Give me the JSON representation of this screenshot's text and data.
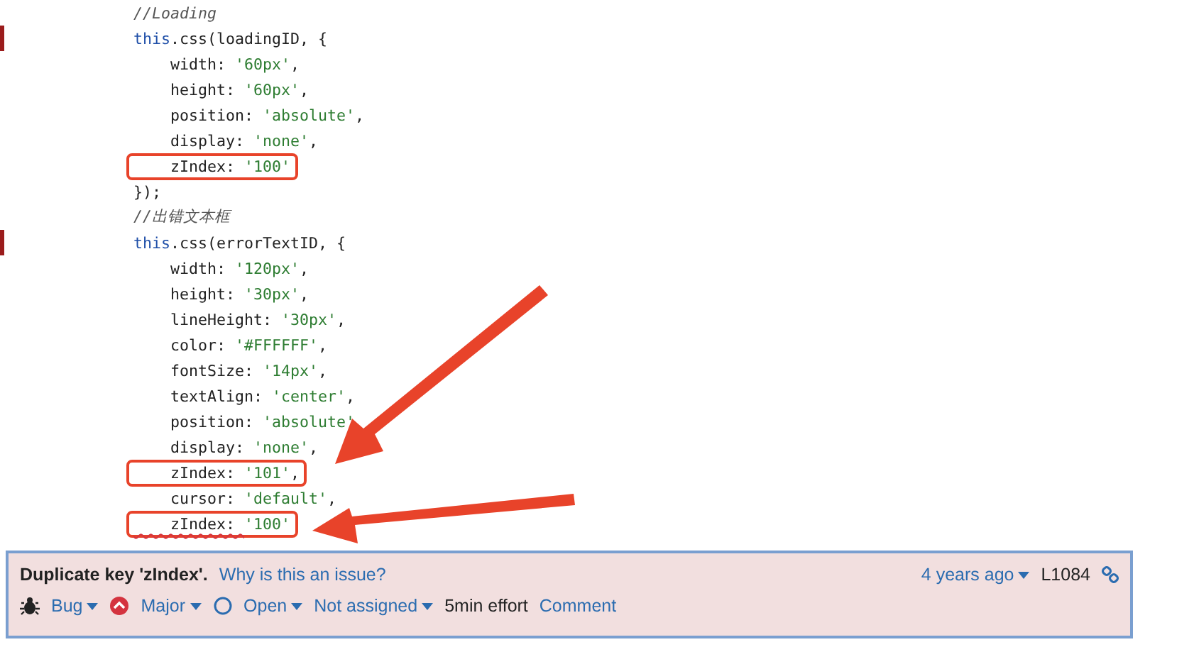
{
  "code_lines": [
    {
      "marked": false,
      "boxed": false,
      "issue": false,
      "tokens": [
        {
          "kind": "comment",
          "text": "//Loading"
        }
      ]
    },
    {
      "marked": true,
      "boxed": false,
      "issue": false,
      "tokens": [
        {
          "kind": "keyword",
          "text": "this"
        },
        {
          "kind": "plain",
          "text": ".css(loadingID, {"
        }
      ]
    },
    {
      "marked": false,
      "boxed": false,
      "issue": false,
      "tokens": [
        {
          "kind": "plain",
          "text": "    width: "
        },
        {
          "kind": "string",
          "text": "'60px'"
        },
        {
          "kind": "plain",
          "text": ","
        }
      ]
    },
    {
      "marked": false,
      "boxed": false,
      "issue": false,
      "tokens": [
        {
          "kind": "plain",
          "text": "    height: "
        },
        {
          "kind": "string",
          "text": "'60px'"
        },
        {
          "kind": "plain",
          "text": ","
        }
      ]
    },
    {
      "marked": false,
      "boxed": false,
      "issue": false,
      "tokens": [
        {
          "kind": "plain",
          "text": "    position: "
        },
        {
          "kind": "string",
          "text": "'absolute'"
        },
        {
          "kind": "plain",
          "text": ","
        }
      ]
    },
    {
      "marked": false,
      "boxed": false,
      "issue": false,
      "tokens": [
        {
          "kind": "plain",
          "text": "    display: "
        },
        {
          "kind": "string",
          "text": "'none'"
        },
        {
          "kind": "plain",
          "text": ","
        }
      ]
    },
    {
      "marked": false,
      "boxed": true,
      "issue": false,
      "tokens": [
        {
          "kind": "plain",
          "text": "    zIndex: "
        },
        {
          "kind": "string",
          "text": "'100'"
        }
      ]
    },
    {
      "marked": false,
      "boxed": false,
      "issue": false,
      "tokens": [
        {
          "kind": "plain",
          "text": "});"
        }
      ]
    },
    {
      "marked": false,
      "boxed": false,
      "issue": false,
      "tokens": [
        {
          "kind": "comment",
          "text": "//出错文本框"
        }
      ]
    },
    {
      "marked": true,
      "boxed": false,
      "issue": false,
      "tokens": [
        {
          "kind": "keyword",
          "text": "this"
        },
        {
          "kind": "plain",
          "text": ".css(errorTextID, {"
        }
      ]
    },
    {
      "marked": false,
      "boxed": false,
      "issue": false,
      "tokens": [
        {
          "kind": "plain",
          "text": "    width: "
        },
        {
          "kind": "string",
          "text": "'120px'"
        },
        {
          "kind": "plain",
          "text": ","
        }
      ]
    },
    {
      "marked": false,
      "boxed": false,
      "issue": false,
      "tokens": [
        {
          "kind": "plain",
          "text": "    height: "
        },
        {
          "kind": "string",
          "text": "'30px'"
        },
        {
          "kind": "plain",
          "text": ","
        }
      ]
    },
    {
      "marked": false,
      "boxed": false,
      "issue": false,
      "tokens": [
        {
          "kind": "plain",
          "text": "    lineHeight: "
        },
        {
          "kind": "string",
          "text": "'30px'"
        },
        {
          "kind": "plain",
          "text": ","
        }
      ]
    },
    {
      "marked": false,
      "boxed": false,
      "issue": false,
      "tokens": [
        {
          "kind": "plain",
          "text": "    color: "
        },
        {
          "kind": "string",
          "text": "'#FFFFFF'"
        },
        {
          "kind": "plain",
          "text": ","
        }
      ]
    },
    {
      "marked": false,
      "boxed": false,
      "issue": false,
      "tokens": [
        {
          "kind": "plain",
          "text": "    fontSize: "
        },
        {
          "kind": "string",
          "text": "'14px'"
        },
        {
          "kind": "plain",
          "text": ","
        }
      ]
    },
    {
      "marked": false,
      "boxed": false,
      "issue": false,
      "tokens": [
        {
          "kind": "plain",
          "text": "    textAlign: "
        },
        {
          "kind": "string",
          "text": "'center'"
        },
        {
          "kind": "plain",
          "text": ","
        }
      ]
    },
    {
      "marked": false,
      "boxed": false,
      "issue": false,
      "tokens": [
        {
          "kind": "plain",
          "text": "    position: "
        },
        {
          "kind": "string",
          "text": "'absolute'"
        }
      ]
    },
    {
      "marked": false,
      "boxed": false,
      "issue": false,
      "tokens": [
        {
          "kind": "plain",
          "text": "    display: "
        },
        {
          "kind": "string",
          "text": "'none'"
        },
        {
          "kind": "plain",
          "text": ","
        }
      ]
    },
    {
      "marked": false,
      "boxed": true,
      "issue": false,
      "tokens": [
        {
          "kind": "plain",
          "text": "    zIndex: "
        },
        {
          "kind": "string",
          "text": "'101'"
        },
        {
          "kind": "plain",
          "text": ","
        }
      ]
    },
    {
      "marked": false,
      "boxed": false,
      "issue": false,
      "tokens": [
        {
          "kind": "plain",
          "text": "    cursor: "
        },
        {
          "kind": "string",
          "text": "'default'"
        },
        {
          "kind": "plain",
          "text": ","
        }
      ]
    },
    {
      "marked": false,
      "boxed": true,
      "issue": true,
      "tokens": [
        {
          "kind": "plain",
          "text": "    zIndex: "
        },
        {
          "kind": "string",
          "text": "'100'"
        }
      ]
    }
  ],
  "issue": {
    "message": "Duplicate key 'zIndex'.",
    "why_link": "Why is this an issue?",
    "age": "4 years ago",
    "line": "L1084",
    "type": "Bug",
    "severity": "Major",
    "status": "Open",
    "assignee": "Not assigned",
    "effort": "5min effort",
    "comment": "Comment"
  }
}
